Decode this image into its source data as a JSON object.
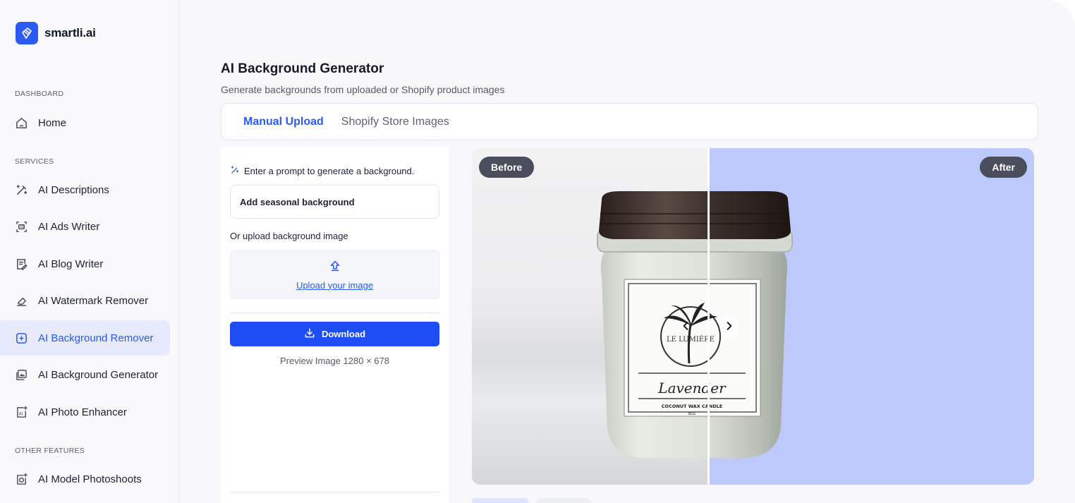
{
  "brand": {
    "name": "smartli.ai"
  },
  "sidebar": {
    "sections": [
      {
        "label": "DASHBOARD"
      },
      {
        "label": "SERVICES"
      },
      {
        "label": "OTHER FEATURES"
      }
    ],
    "items": [
      {
        "label": "Home",
        "icon": "home-icon"
      },
      {
        "label": "AI Descriptions",
        "icon": "magic-wand-icon"
      },
      {
        "label": "AI Ads Writer",
        "icon": "ad-frame-icon"
      },
      {
        "label": "AI Blog Writer",
        "icon": "document-pen-icon"
      },
      {
        "label": "AI Watermark Remover",
        "icon": "eraser-icon"
      },
      {
        "label": "AI Background Remover",
        "icon": "sparkle-image-icon",
        "active": true
      },
      {
        "label": "AI Background Generator",
        "icon": "image-gallery-icon"
      },
      {
        "label": "AI Photo Enhancer",
        "icon": "ai-image-icon"
      },
      {
        "label": "AI Model Photoshoots",
        "icon": "camera-sparkle-icon"
      }
    ]
  },
  "main": {
    "title": "AI Background Generator",
    "subtitle": "Generate backgrounds from uploaded or Shopify product images",
    "tabs": [
      {
        "label": "Manual Upload",
        "active": true
      },
      {
        "label": "Shopify Store Images",
        "active": false
      }
    ]
  },
  "panel": {
    "prompt_hint": "Enter a prompt to generate a background.",
    "prompt_value": "Add seasonal background",
    "upload_hint": "Or upload background image",
    "upload_link": "Upload your image",
    "download_label": "Download",
    "preview_info": "Preview Image 1280 × 678"
  },
  "viewer": {
    "before_label": "Before",
    "after_label": "After",
    "product_label": {
      "brand": "LE LUMIÈRE",
      "name": "Lavender",
      "line": "COCONUT WAX CANDLE",
      "size": "8OZ"
    },
    "after_bg_color": "#bdc9fb"
  },
  "colors": {
    "accent": "#2a5bf5",
    "active_bg": "#e6eafc"
  }
}
